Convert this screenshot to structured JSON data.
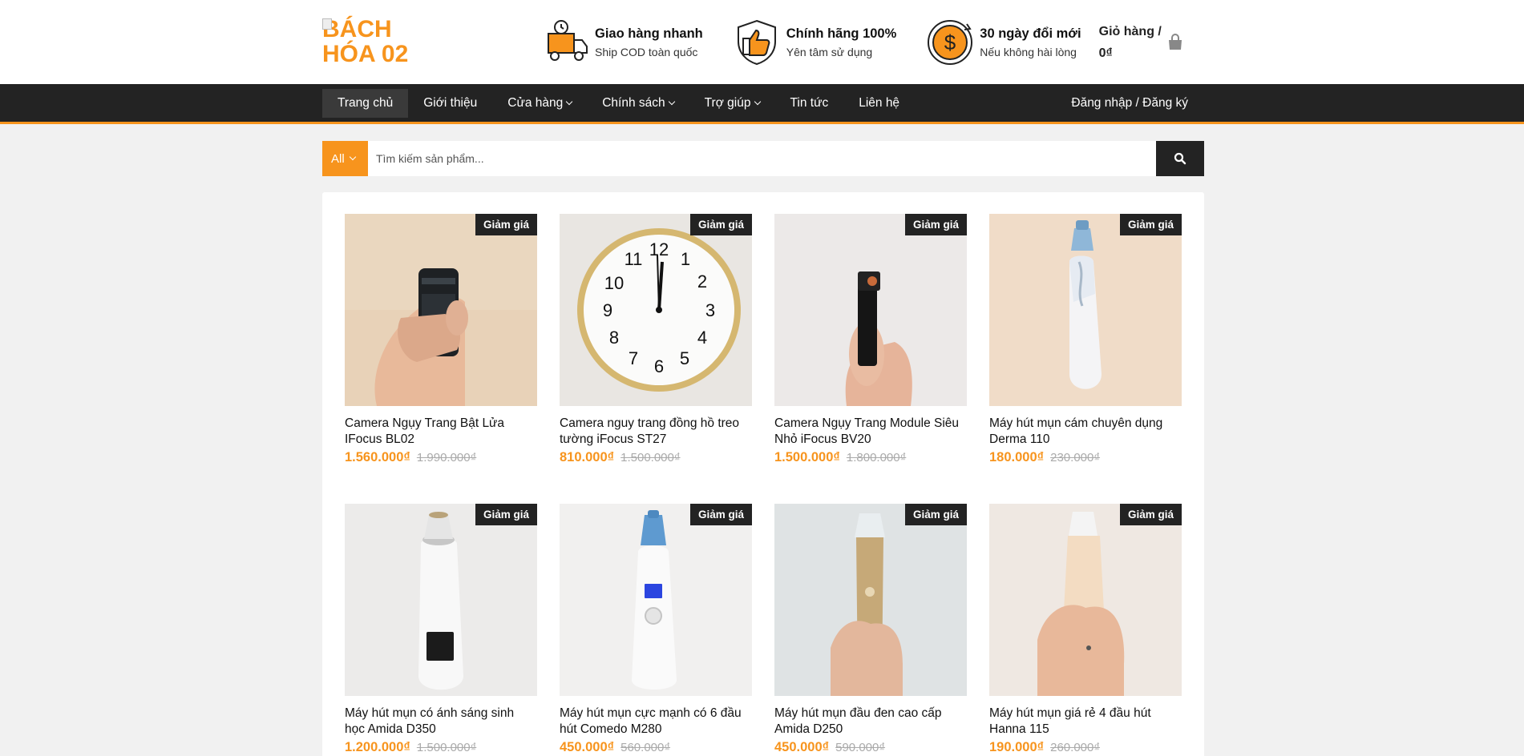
{
  "header": {
    "logo_text": "BÁCH HÓA 02",
    "features": [
      {
        "icon": "delivery-truck-icon",
        "title": "Giao hàng nhanh",
        "subtitle": "Ship COD toàn quốc"
      },
      {
        "icon": "shield-thumb-icon",
        "title": "Chính hãng 100%",
        "subtitle": "Yên tâm sử dụng"
      },
      {
        "icon": "dollar-return-icon",
        "title": "30 ngày đổi mới",
        "subtitle": "Nếu không hài lòng"
      }
    ],
    "cart_label": "Giỏ hàng /",
    "cart_total": "0₫"
  },
  "nav": {
    "items": [
      {
        "label": "Trang chủ",
        "dropdown": false
      },
      {
        "label": "Giới thiệu",
        "dropdown": false
      },
      {
        "label": "Cửa hàng",
        "dropdown": true
      },
      {
        "label": "Chính sách",
        "dropdown": true
      },
      {
        "label": "Trợ giúp",
        "dropdown": true
      },
      {
        "label": "Tin tức",
        "dropdown": false
      },
      {
        "label": "Liên hệ",
        "dropdown": false
      }
    ],
    "account": "Đăng nhập / Đăng ký"
  },
  "search": {
    "category": "All",
    "placeholder": "Tìm kiếm sản phẩm..."
  },
  "colors": {
    "accent": "#f7941d",
    "dark": "#232323",
    "background": "#f1f1f1"
  },
  "products": [
    {
      "badge": "Giảm giá",
      "name": "Camera Ngụy Trang Bật Lửa IFocus BL02",
      "price": "1.560.000₫",
      "old_price": "1.990.000₫",
      "image": "lighter-camera"
    },
    {
      "badge": "Giảm giá",
      "name": "Camera nguy trang đồng hồ treo tường iFocus ST27",
      "price": "810.000₫",
      "old_price": "1.500.000₫",
      "image": "wall-clock"
    },
    {
      "badge": "Giảm giá",
      "name": "Camera Ngụy Trang Module Siêu Nhỏ iFocus BV20",
      "price": "1.500.000₫",
      "old_price": "1.800.000₫",
      "image": "mini-module-camera"
    },
    {
      "badge": "Giảm giá",
      "name": "Máy hút mụn cám chuyên dụng Derma 110",
      "price": "180.000₫",
      "old_price": "230.000₫",
      "image": "blackhead-device-blue"
    },
    {
      "badge": "Giảm giá",
      "name": "Máy hút mụn có ánh sáng sinh học Amida D350",
      "price": "1.200.000₫",
      "old_price": "1.500.000₫",
      "image": "blackhead-device-screen"
    },
    {
      "badge": "Giảm giá",
      "name": "Máy hút mụn cực mạnh có 6 đầu hút Comedo M280",
      "price": "450.000₫",
      "old_price": "560.000₫",
      "image": "blackhead-device-blue-screen"
    },
    {
      "badge": "Giảm giá",
      "name": "Máy hút mụn đầu đen cao cấp Amida D250",
      "price": "450.000₫",
      "old_price": "590.000₫",
      "image": "blackhead-device-gold"
    },
    {
      "badge": "Giảm giá",
      "name": "Máy hút mụn giá rẻ 4 đầu hút Hanna 115",
      "price": "190.000₫",
      "old_price": "260.000₫",
      "image": "blackhead-device-champagne"
    }
  ]
}
